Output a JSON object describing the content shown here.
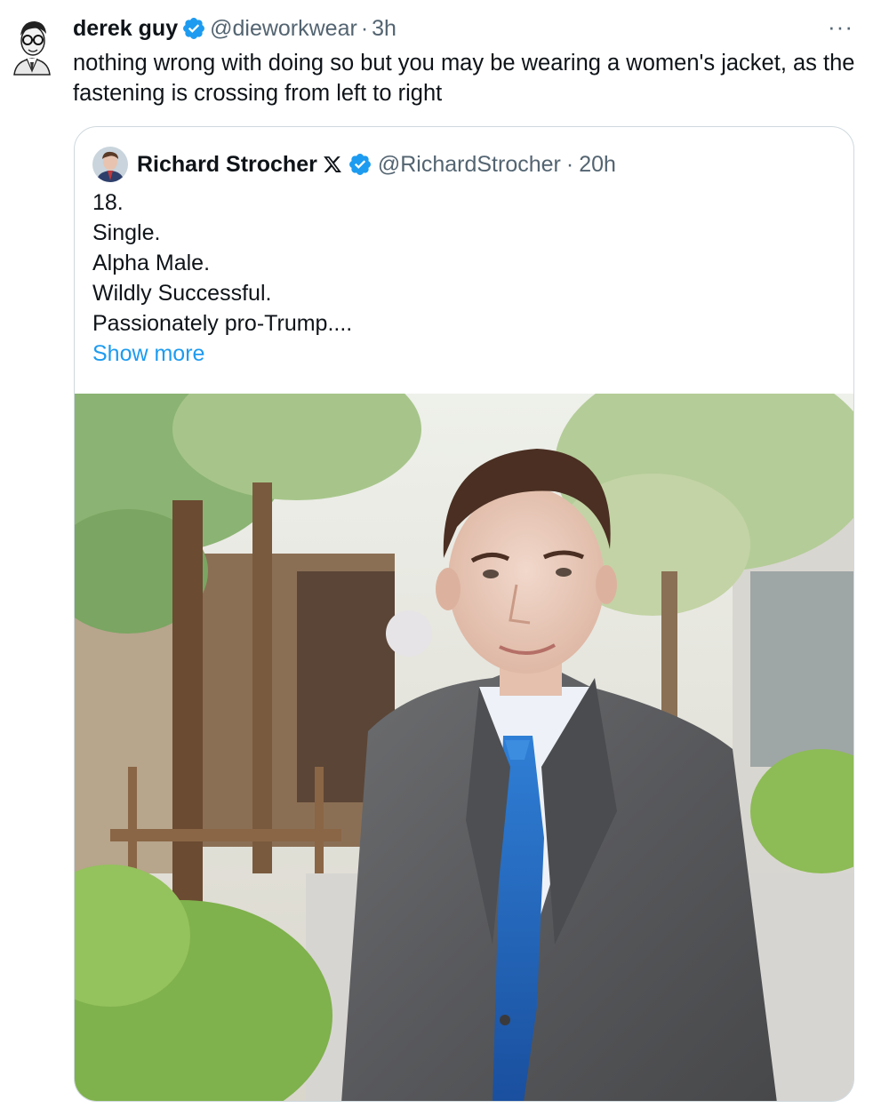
{
  "tweet": {
    "author_name": "derek guy",
    "handle": "@dieworkwear",
    "separator": "·",
    "time": "3h",
    "more_label": "···",
    "text": "nothing wrong with doing so but you may be wearing a women's jacket, as the fastening is crossing from left to right"
  },
  "quoted": {
    "author_name": "Richard Strocher",
    "handle": "@RichardStrocher",
    "separator": "·",
    "time": "20h",
    "lines": [
      "18.",
      "Single.",
      "Alpha Male.",
      "Wildly Successful.",
      "Passionately pro-Trump...."
    ],
    "show_more": "Show more"
  },
  "colors": {
    "verified": "#1d9bf0",
    "link": "#1d9bf0",
    "secondary_text": "#536471",
    "border": "#cfd9de"
  },
  "icons": {
    "verified": "verified-badge-icon",
    "x_logo": "x-logo-icon",
    "more": "more-horizontal-icon"
  }
}
